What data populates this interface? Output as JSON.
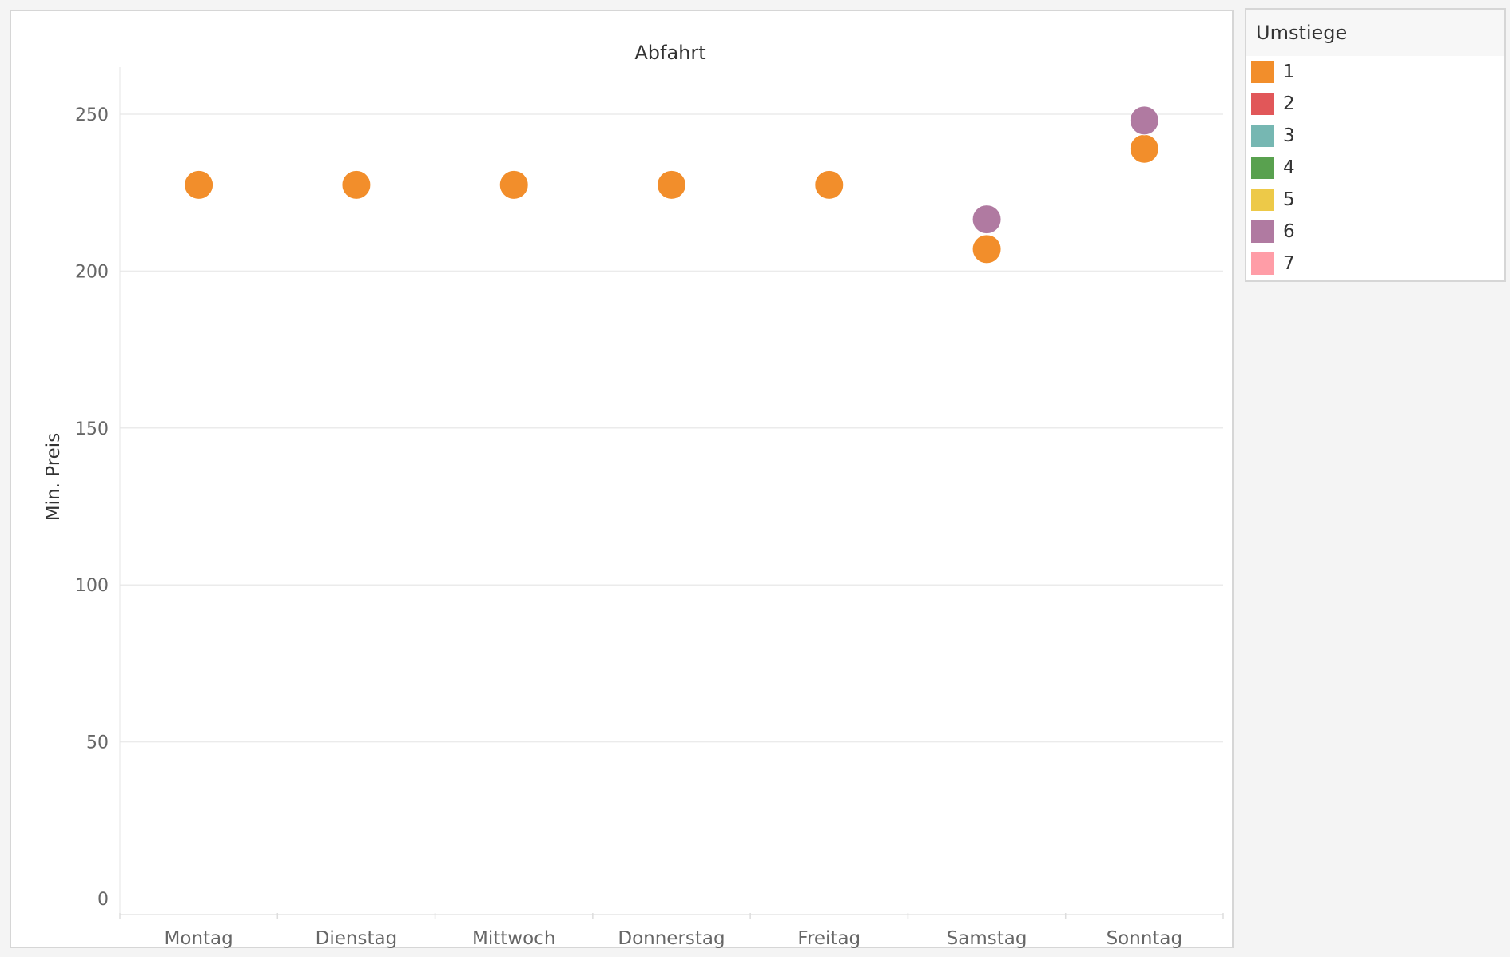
{
  "chart_data": {
    "type": "scatter",
    "title": "Abfahrt",
    "xlabel": "",
    "ylabel": "Min. Preis",
    "categories": [
      "Montag",
      "Dienstag",
      "Mittwoch",
      "Donnerstag",
      "Freitag",
      "Samstag",
      "Sonntag"
    ],
    "ylim": [
      0,
      265
    ],
    "yticks": [
      0,
      50,
      100,
      150,
      200,
      250
    ],
    "grid": true,
    "legend_placement": "right",
    "series": [
      {
        "name": "1",
        "color": "#f28e2b",
        "values": [
          227.5,
          227.5,
          227.5,
          227.5,
          227.5,
          207,
          239
        ]
      },
      {
        "name": "2",
        "color": "#e15759",
        "values": [
          null,
          null,
          null,
          null,
          null,
          null,
          null
        ]
      },
      {
        "name": "3",
        "color": "#76b7b2",
        "values": [
          null,
          null,
          null,
          null,
          null,
          null,
          null
        ]
      },
      {
        "name": "4",
        "color": "#59a14f",
        "values": [
          null,
          null,
          null,
          null,
          null,
          null,
          null
        ]
      },
      {
        "name": "5",
        "color": "#edc948",
        "values": [
          null,
          null,
          null,
          null,
          null,
          null,
          null
        ]
      },
      {
        "name": "6",
        "color": "#b07aa1",
        "values": [
          null,
          null,
          null,
          null,
          null,
          216.5,
          248
        ]
      },
      {
        "name": "7",
        "color": "#ff9da7",
        "values": [
          null,
          null,
          null,
          null,
          null,
          null,
          null
        ]
      }
    ]
  },
  "legend": {
    "title": "Umstiege",
    "items": [
      {
        "label": "1",
        "color": "#f28e2b"
      },
      {
        "label": "2",
        "color": "#e15759"
      },
      {
        "label": "3",
        "color": "#76b7b2"
      },
      {
        "label": "4",
        "color": "#59a14f"
      },
      {
        "label": "5",
        "color": "#edc948"
      },
      {
        "label": "6",
        "color": "#b07aa1"
      },
      {
        "label": "7",
        "color": "#ff9da7"
      }
    ]
  }
}
